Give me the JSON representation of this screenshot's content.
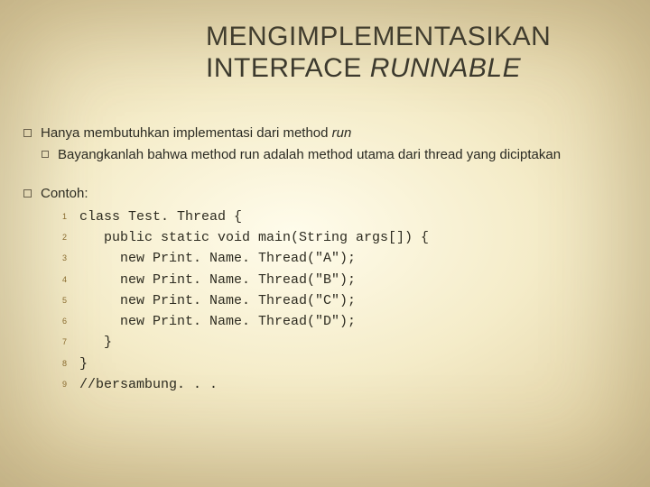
{
  "title": {
    "line1": "MENGIMPLEMENTASIKAN",
    "line2_a": "INTERFACE ",
    "line2_b": "RUNNABLE"
  },
  "section1": {
    "main_a": "Hanya membutuhkan implementasi dari method ",
    "main_b": "run",
    "sub": "Bayangkanlah bahwa method run adalah method utama dari thread yang diciptakan"
  },
  "section2": {
    "label": "Contoh:",
    "lines": [
      {
        "n": "1",
        "code": "class Test. Thread {"
      },
      {
        "n": "2",
        "code": "   public static void main(String args[]) {"
      },
      {
        "n": "3",
        "code": "     new Print. Name. Thread(\"A\");"
      },
      {
        "n": "4",
        "code": "     new Print. Name. Thread(\"B\");"
      },
      {
        "n": "5",
        "code": "     new Print. Name. Thread(\"C\");"
      },
      {
        "n": "6",
        "code": "     new Print. Name. Thread(\"D\");"
      },
      {
        "n": "7",
        "code": "   }"
      },
      {
        "n": "8",
        "code": "}"
      },
      {
        "n": "9",
        "code": "//bersambung. . ."
      }
    ]
  }
}
